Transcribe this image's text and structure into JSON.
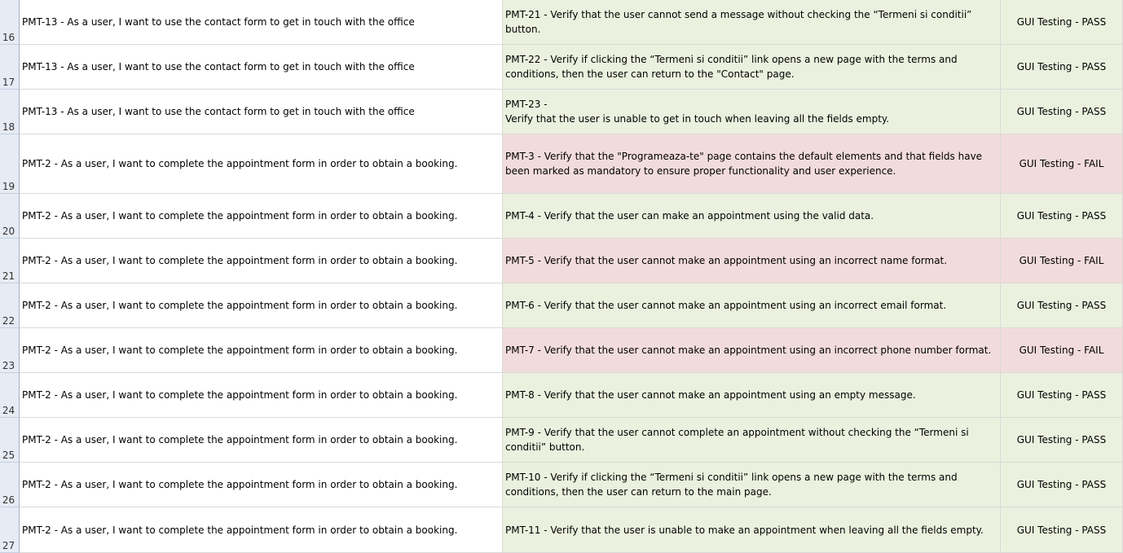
{
  "colors": {
    "pass_bg": "#ebf1de",
    "fail_bg": "#f2dcdb",
    "header_bg": "#e6ebf4"
  },
  "rows": [
    {
      "num": "16",
      "story": "PMT-13 - As a user, I want to use the contact form to get in touch with the office",
      "test": "PMT-21 - Verify that the user cannot send a message without checking the “Termeni si conditii”\nbutton.",
      "result": "GUI Testing  - PASS",
      "status": "pass"
    },
    {
      "num": "17",
      "story": "PMT-13 - As a user, I want to use the contact form to get in touch with the office",
      "test": "PMT-22 - Verify if clicking the “Termeni si conditii” link opens a new page with the terms and\nconditions, then the user can return to the \"Contact\" page.",
      "result": "GUI Testing  - PASS",
      "status": "pass"
    },
    {
      "num": "18",
      "story": "PMT-13 - As a user, I want to use the contact form to get in touch with the office",
      "test": "PMT-23 -\nVerify that the user is unable to get in touch when leaving all the fields empty.",
      "result": "GUI Testing  - PASS",
      "status": "pass"
    },
    {
      "num": "19",
      "story": "PMT-2 - As a user, I want to complete the appointment form in order to obtain a booking.",
      "test": "PMT-3 - Verify that the \"Programeaza-te\" page contains the default elements and that fields have\nbeen marked as mandatory to ensure proper functionality and user experience.",
      "result": "GUI Testing  - FAIL",
      "status": "fail"
    },
    {
      "num": "20",
      "story": "PMT-2 - As a user, I want to complete the appointment form in order to obtain a booking.",
      "test": "PMT-4 - Verify that the user can make an appointment using the valid data.",
      "result": "GUI Testing  - PASS",
      "status": "pass"
    },
    {
      "num": "21",
      "story": "PMT-2 - As a user, I want to complete the appointment form in order to obtain a booking.",
      "test": "PMT-5 - Verify that the user cannot make an appointment using an incorrect name format.",
      "result": "GUI Testing  - FAIL",
      "status": "fail"
    },
    {
      "num": "22",
      "story": "PMT-2 - As a user, I want to complete the appointment form in order to obtain a booking.",
      "test": "PMT-6 - Verify that the user cannot make an appointment using an incorrect email format.",
      "result": "GUI Testing  - PASS",
      "status": "pass"
    },
    {
      "num": "23",
      "story": "PMT-2 - As a user, I want to complete the appointment form in order to obtain a booking.",
      "test": "PMT-7 - Verify that the user cannot make an appointment using an incorrect phone number format.",
      "result": "GUI Testing  - FAIL",
      "status": "fail"
    },
    {
      "num": "24",
      "story": "PMT-2 - As a user, I want to complete the appointment form in order to obtain a booking.",
      "test": "PMT-8 - Verify that the user cannot make an appointment using an empty message.",
      "result": "GUI Testing  - PASS",
      "status": "pass"
    },
    {
      "num": "25",
      "story": "PMT-2 - As a user, I want to complete the appointment form in order to obtain a booking.",
      "test": "PMT-9 - Verify that the user cannot complete an appointment without checking the “Termeni si\nconditii” button.",
      "result": "GUI Testing  - PASS",
      "status": "pass"
    },
    {
      "num": "26",
      "story": "PMT-2 - As a user, I want to complete the appointment form in order to obtain a booking.",
      "test": "PMT-10 - Verify if clicking the “Termeni si conditii” link opens a new page with the terms and\nconditions, then the user can return to the main page.",
      "result": "GUI Testing  - PASS",
      "status": "pass"
    },
    {
      "num": "27",
      "story": "PMT-2 - As a user, I want to complete the appointment form in order to obtain a booking.",
      "test": "PMT-11 - Verify that the user is unable to make an appointment when leaving all the fields empty.",
      "result": "GUI Testing  - PASS",
      "status": "pass"
    }
  ]
}
